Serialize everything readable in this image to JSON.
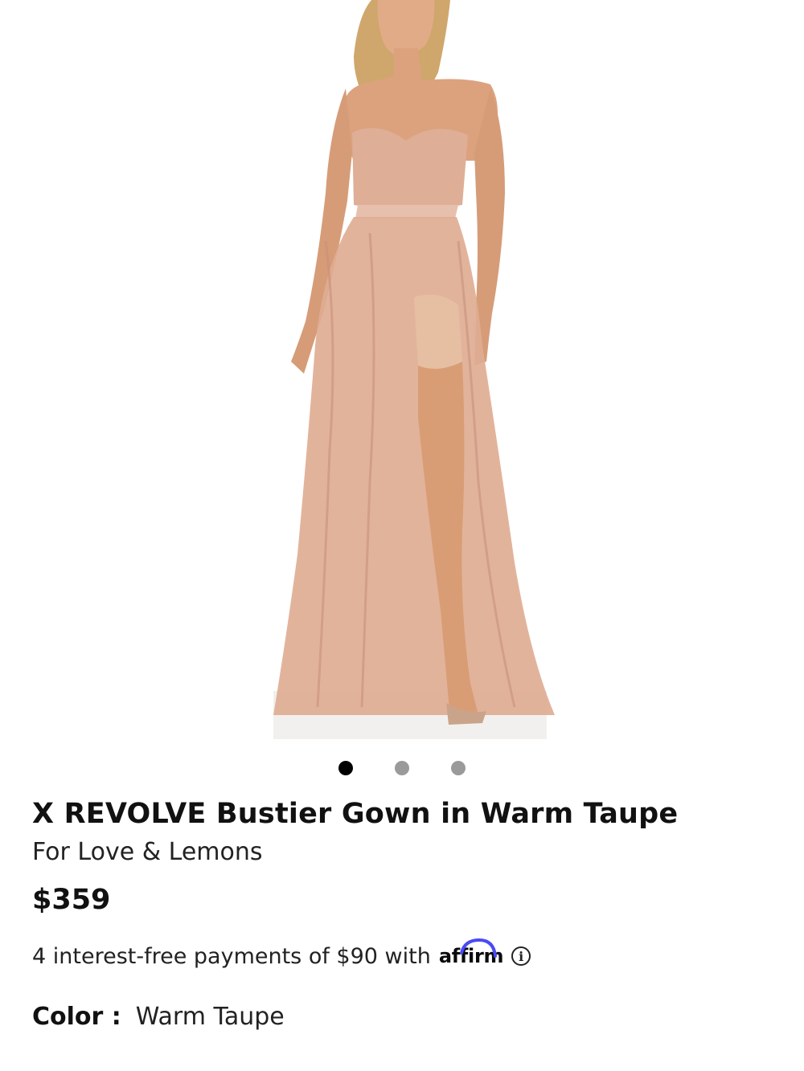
{
  "gallery": {
    "image_alt": "Model wearing bustier gown with ruffled tulle skirt",
    "dots": [
      {
        "state": "active"
      },
      {
        "state": "inactive"
      },
      {
        "state": "inactive"
      }
    ]
  },
  "product": {
    "title": "X REVOLVE Bustier Gown in Warm Taupe",
    "brand": "For Love & Lemons",
    "price": "$359"
  },
  "financing": {
    "text": "4 interest-free payments of $90 with",
    "provider": "affirm",
    "info_icon": "info-circle-icon"
  },
  "color": {
    "label": "Color :",
    "value": "Warm Taupe"
  },
  "colors": {
    "dress": "#e0ad92",
    "skin": "#d9a07c",
    "hair": "#c9a46a",
    "accent_affirm": "#4a4af4"
  }
}
